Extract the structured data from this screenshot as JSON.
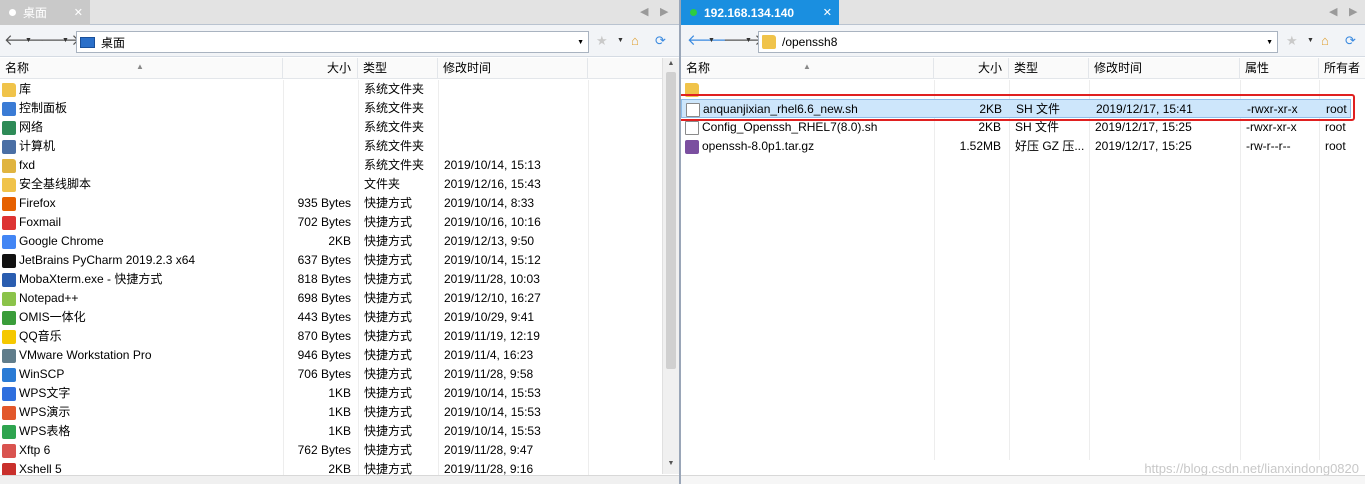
{
  "left": {
    "tab_title": "桌面",
    "path": "桌面",
    "headers": {
      "name": "名称",
      "size": "大小",
      "type": "类型",
      "modified": "修改时间"
    },
    "rows": [
      {
        "name": "库",
        "size": "",
        "type": "系统文件夹",
        "modified": "",
        "icon": "library-icon"
      },
      {
        "name": "控制面板",
        "size": "",
        "type": "系统文件夹",
        "modified": "",
        "icon": "control-panel-icon"
      },
      {
        "name": "网络",
        "size": "",
        "type": "系统文件夹",
        "modified": "",
        "icon": "network-icon"
      },
      {
        "name": "计算机",
        "size": "",
        "type": "系统文件夹",
        "modified": "",
        "icon": "computer-icon"
      },
      {
        "name": "fxd",
        "size": "",
        "type": "系统文件夹",
        "modified": "2019/10/14, 15:13",
        "icon": "user-folder-icon"
      },
      {
        "name": "安全基线脚本",
        "size": "",
        "type": "文件夹",
        "modified": "2019/12/16, 15:43",
        "icon": "folder-icon"
      },
      {
        "name": "Firefox",
        "size": "935 Bytes",
        "type": "快捷方式",
        "modified": "2019/10/14, 8:33",
        "icon": "firefox-icon"
      },
      {
        "name": "Foxmail",
        "size": "702 Bytes",
        "type": "快捷方式",
        "modified": "2019/10/16, 10:16",
        "icon": "foxmail-icon"
      },
      {
        "name": "Google Chrome",
        "size": "2KB",
        "type": "快捷方式",
        "modified": "2019/12/13, 9:50",
        "icon": "chrome-icon"
      },
      {
        "name": "JetBrains PyCharm 2019.2.3 x64",
        "size": "637 Bytes",
        "type": "快捷方式",
        "modified": "2019/10/14, 15:12",
        "icon": "pycharm-icon"
      },
      {
        "name": "MobaXterm.exe - 快捷方式",
        "size": "818 Bytes",
        "type": "快捷方式",
        "modified": "2019/11/28, 10:03",
        "icon": "mobaxterm-icon"
      },
      {
        "name": "Notepad++",
        "size": "698 Bytes",
        "type": "快捷方式",
        "modified": "2019/12/10, 16:27",
        "icon": "notepadpp-icon"
      },
      {
        "name": "OMIS一体化",
        "size": "443 Bytes",
        "type": "快捷方式",
        "modified": "2019/10/29, 9:41",
        "icon": "omis-icon"
      },
      {
        "name": "QQ音乐",
        "size": "870 Bytes",
        "type": "快捷方式",
        "modified": "2019/11/19, 12:19",
        "icon": "qqmusic-icon"
      },
      {
        "name": "VMware Workstation Pro",
        "size": "946 Bytes",
        "type": "快捷方式",
        "modified": "2019/11/4, 16:23",
        "icon": "vmware-icon"
      },
      {
        "name": "WinSCP",
        "size": "706 Bytes",
        "type": "快捷方式",
        "modified": "2019/11/28, 9:58",
        "icon": "winscp-icon"
      },
      {
        "name": "WPS文字",
        "size": "1KB",
        "type": "快捷方式",
        "modified": "2019/10/14, 15:53",
        "icon": "wps-writer-icon"
      },
      {
        "name": "WPS演示",
        "size": "1KB",
        "type": "快捷方式",
        "modified": "2019/10/14, 15:53",
        "icon": "wps-presentation-icon"
      },
      {
        "name": "WPS表格",
        "size": "1KB",
        "type": "快捷方式",
        "modified": "2019/10/14, 15:53",
        "icon": "wps-spreadsheet-icon"
      },
      {
        "name": "Xftp 6",
        "size": "762 Bytes",
        "type": "快捷方式",
        "modified": "2019/11/28, 9:47",
        "icon": "xftp-icon"
      },
      {
        "name": "Xshell 5",
        "size": "2KB",
        "type": "快捷方式",
        "modified": "2019/11/28, 9:16",
        "icon": "xshell-icon"
      }
    ]
  },
  "right": {
    "tab_title": "192.168.134.140",
    "path": "/openssh8",
    "headers": {
      "name": "名称",
      "size": "大小",
      "type": "类型",
      "modified": "修改时间",
      "attrs": "属性",
      "owner": "所有者"
    },
    "rows": [
      {
        "name": "",
        "size": "",
        "type": "",
        "modified": "",
        "attrs": "",
        "owner": "",
        "icon": "parent-folder-icon"
      },
      {
        "name": "anquanjixian_rhel6.6_new.sh",
        "size": "2KB",
        "type": "SH 文件",
        "modified": "2019/12/17, 15:41",
        "attrs": "-rwxr-xr-x",
        "owner": "root",
        "icon": "script-file-icon",
        "selected": true
      },
      {
        "name": "Config_Openssh_RHEL7(8.0).sh",
        "size": "2KB",
        "type": "SH 文件",
        "modified": "2019/12/17, 15:25",
        "attrs": "-rwxr-xr-x",
        "owner": "root",
        "icon": "script-file-icon"
      },
      {
        "name": "openssh-8.0p1.tar.gz",
        "size": "1.52MB",
        "type": "好压 GZ 压...",
        "modified": "2019/12/17, 15:25",
        "attrs": "-rw-r--r--",
        "owner": "root",
        "icon": "archive-icon"
      }
    ]
  },
  "watermark": "https://blog.csdn.net/lianxindong0820",
  "colors": {
    "tab_active": "#1a8fe0",
    "connected_dot": "#2ecc40",
    "selection": "#cde6fb",
    "highlight": "#e02020"
  }
}
